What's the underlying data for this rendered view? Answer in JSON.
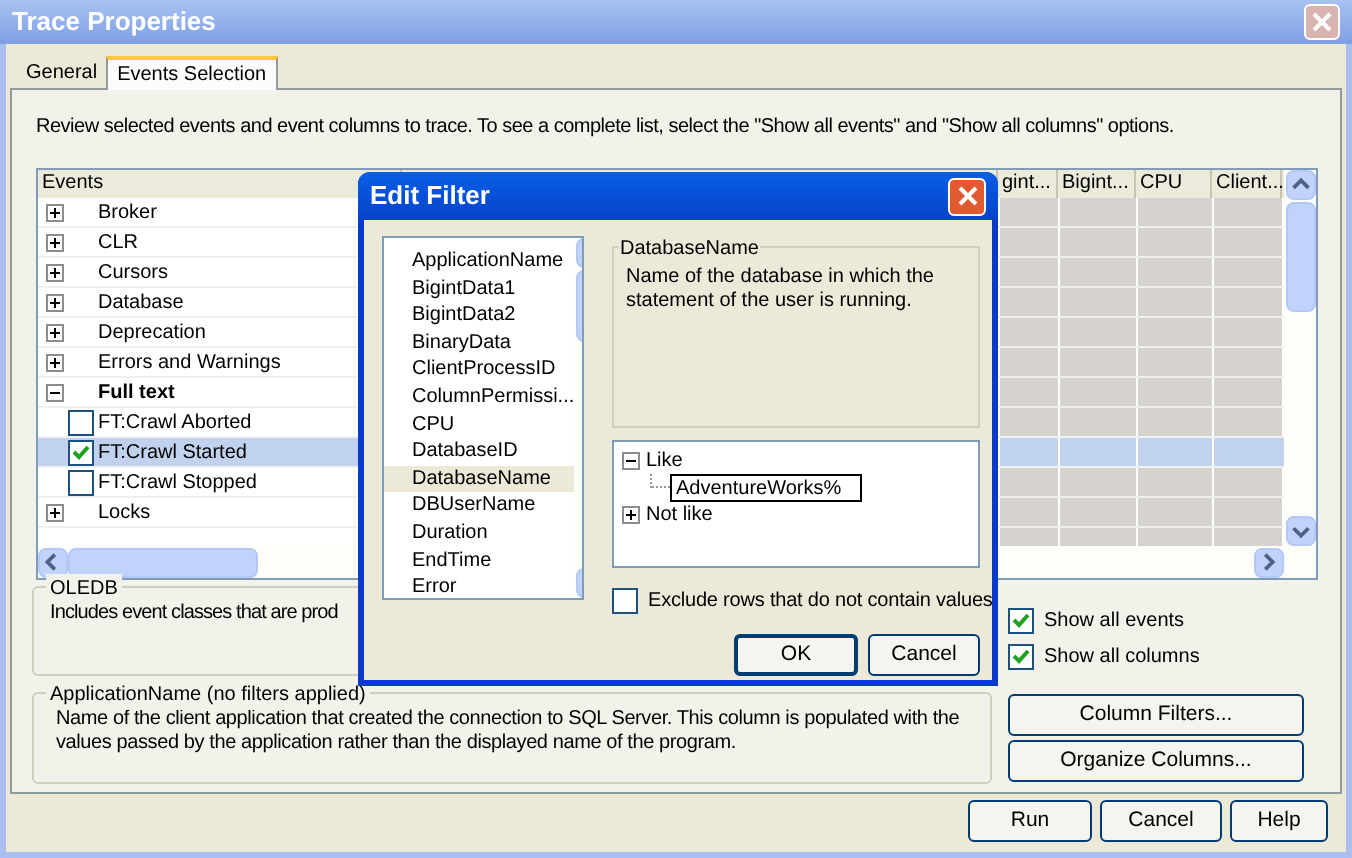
{
  "window": {
    "title": "Trace Properties"
  },
  "tabs": [
    {
      "label": "General",
      "selected": false
    },
    {
      "label": "Events Selection",
      "selected": true
    }
  ],
  "description": "Review selected events and event columns to trace. To see a complete list, select the \"Show all events\" and \"Show all columns\" options.",
  "events_grid": {
    "columns": [
      "Events",
      "gint...",
      "Bigint...",
      "CPU",
      "Client..."
    ],
    "rows": [
      {
        "kind": "category",
        "label": "Broker",
        "expanded": false,
        "active": false,
        "selected": false
      },
      {
        "kind": "category",
        "label": "CLR",
        "expanded": false,
        "active": false,
        "selected": false
      },
      {
        "kind": "category",
        "label": "Cursors",
        "expanded": false,
        "active": false,
        "selected": false
      },
      {
        "kind": "category",
        "label": "Database",
        "expanded": false,
        "active": false,
        "selected": false
      },
      {
        "kind": "category",
        "label": "Deprecation",
        "expanded": false,
        "active": false,
        "selected": false
      },
      {
        "kind": "category",
        "label": "Errors and Warnings",
        "expanded": false,
        "active": false,
        "selected": false
      },
      {
        "kind": "category",
        "label": "Full text",
        "expanded": true,
        "active": true,
        "selected": false
      },
      {
        "kind": "event",
        "label": "FT:Crawl Aborted",
        "checked": false,
        "selected": false
      },
      {
        "kind": "event",
        "label": "FT:Crawl Started",
        "checked": true,
        "selected": true
      },
      {
        "kind": "event",
        "label": "FT:Crawl Stopped",
        "checked": false,
        "selected": false
      },
      {
        "kind": "category",
        "label": "Locks",
        "expanded": false,
        "active": false,
        "selected": false
      }
    ]
  },
  "event_info": {
    "title": "OLEDB",
    "text": "Includes event classes that are prod"
  },
  "options": [
    {
      "label": "Show all events",
      "checked": true
    },
    {
      "label": "Show all columns",
      "checked": true
    }
  ],
  "column_info": {
    "title": "ApplicationName (no filters applied)",
    "text": "Name of the client application that created the connection to SQL Server. This column is populated with the values passed by the application rather than the displayed name of the program."
  },
  "side_buttons": [
    "Column Filters...",
    "Organize Columns..."
  ],
  "buttons": [
    "Run",
    "Cancel",
    "Help"
  ],
  "dialog": {
    "title": "Edit Filter",
    "columns": [
      {
        "label": "ApplicationName",
        "selected": false
      },
      {
        "label": "BigintData1",
        "selected": false
      },
      {
        "label": "BigintData2",
        "selected": false
      },
      {
        "label": "BinaryData",
        "selected": false
      },
      {
        "label": "ClientProcessID",
        "selected": false
      },
      {
        "label": "ColumnPermissi...",
        "selected": false
      },
      {
        "label": "CPU",
        "selected": false
      },
      {
        "label": "DatabaseID",
        "selected": false
      },
      {
        "label": "DatabaseName",
        "selected": true
      },
      {
        "label": "DBUserName",
        "selected": false
      },
      {
        "label": "Duration",
        "selected": false
      },
      {
        "label": "EndTime",
        "selected": false
      },
      {
        "label": "Error",
        "selected": false
      }
    ],
    "detail": {
      "title": "DatabaseName",
      "text": "Name of the database in which the statement of the user is running."
    },
    "filters": [
      {
        "label": "Like",
        "expanded": true,
        "children": [
          {
            "value": "AdventureWorks%"
          }
        ]
      },
      {
        "label": "Not like",
        "expanded": false
      }
    ],
    "exclude": {
      "label": "Exclude rows that do not contain values",
      "checked": false
    },
    "buttons": [
      "OK",
      "Cancel"
    ]
  }
}
